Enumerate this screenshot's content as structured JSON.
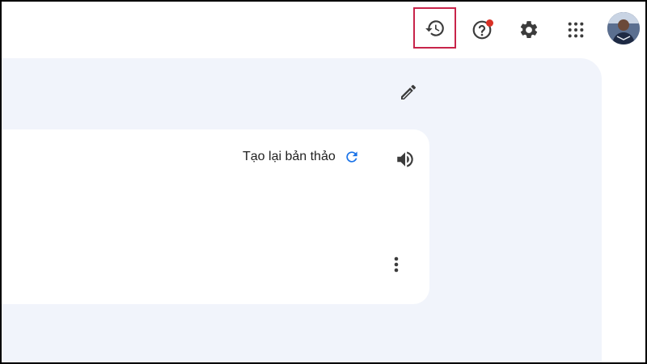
{
  "header": {
    "icons": [
      "history-icon",
      "help-icon",
      "settings-icon",
      "apps-grid-icon",
      "avatar"
    ],
    "highlight_color": "#c8244a",
    "notification_color": "#d93025"
  },
  "draft": {
    "regenerate_label": "Tạo lại bản thảo",
    "accent_color": "#1a73e8"
  }
}
